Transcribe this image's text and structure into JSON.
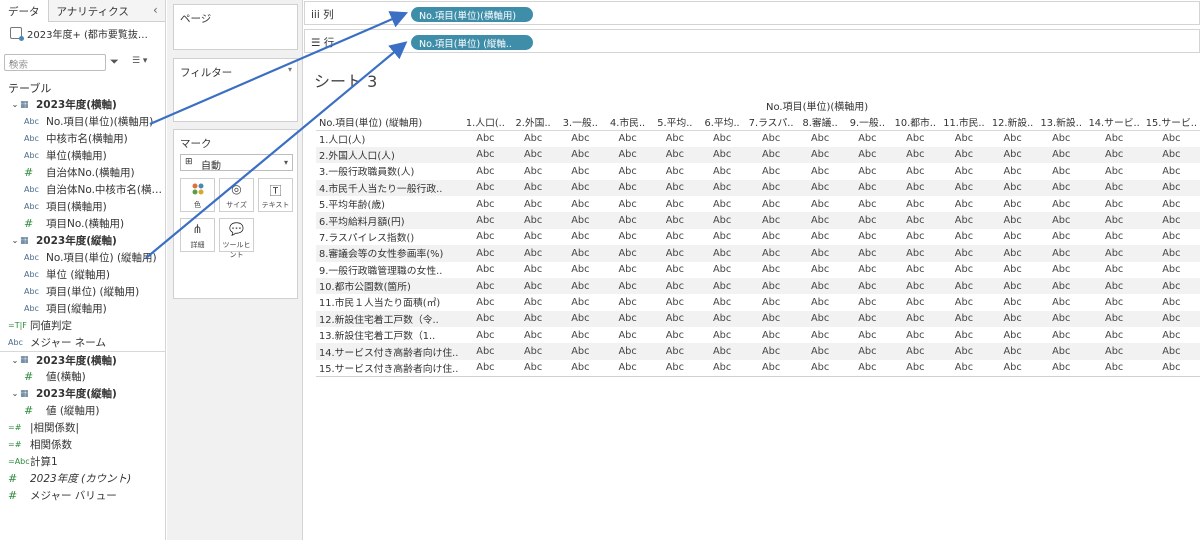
{
  "datapane": {
    "tabs": [
      "データ",
      "アナリティクス"
    ],
    "collapse_glyph": "‹",
    "datasource": "2023年度+ (都市要覧抜…",
    "search_placeholder": "検索",
    "section": "テーブル",
    "fields": [
      {
        "kind": "group",
        "label": "2023年度(横軸)"
      },
      {
        "kind": "field",
        "type": "Abc",
        "label": "No.項目(単位)(横軸用)"
      },
      {
        "kind": "field",
        "type": "Abc",
        "label": "中核市名(横軸用)"
      },
      {
        "kind": "field",
        "type": "Abc",
        "label": "単位(横軸用)"
      },
      {
        "kind": "field",
        "type": "#",
        "label": "自治体No.(横軸用)"
      },
      {
        "kind": "field",
        "type": "Abc",
        "label": "自治体No.中核市名(横…"
      },
      {
        "kind": "field",
        "type": "Abc",
        "label": "項目(横軸用)"
      },
      {
        "kind": "field",
        "type": "#",
        "label": "項目No.(横軸用)"
      },
      {
        "kind": "group",
        "label": "2023年度(縦軸)"
      },
      {
        "kind": "field",
        "type": "Abc",
        "label": "No.項目(単位) (縦軸用)"
      },
      {
        "kind": "field",
        "type": "Abc",
        "label": "単位 (縦軸用)"
      },
      {
        "kind": "field",
        "type": "Abc",
        "label": "項目(単位) (縦軸用)"
      },
      {
        "kind": "field",
        "type": "Abc",
        "label": "項目(縦軸用)"
      },
      {
        "kind": "root",
        "type": "=T|F",
        "label": "同値判定"
      },
      {
        "kind": "root",
        "type": "Abc",
        "label": "メジャー ネーム"
      },
      {
        "kind": "group",
        "label": "2023年度(横軸)",
        "sep": true
      },
      {
        "kind": "field",
        "type": "#",
        "label": "値(横軸)"
      },
      {
        "kind": "group",
        "label": "2023年度(縦軸)"
      },
      {
        "kind": "field",
        "type": "#",
        "label": "値 (縦軸用)"
      },
      {
        "kind": "root",
        "type": "=#",
        "label": "|相関係数|"
      },
      {
        "kind": "root",
        "type": "=#",
        "label": "相関係数"
      },
      {
        "kind": "root",
        "type": "=Abc",
        "label": "計算1"
      },
      {
        "kind": "root",
        "type": "#",
        "label": "2023年度 (カウント)",
        "italic": true
      },
      {
        "kind": "root",
        "type": "#",
        "label": "メジャー バリュー"
      }
    ]
  },
  "cards": {
    "pages_label": "ページ",
    "filters_label": "フィルター",
    "marks_label": "マーク",
    "mark_type": "自動",
    "mark_buttons": [
      {
        "name": "color",
        "label": "色"
      },
      {
        "name": "size",
        "label": "サイズ"
      },
      {
        "name": "text",
        "label": "テキスト"
      },
      {
        "name": "detail",
        "label": "詳細"
      },
      {
        "name": "tooltip",
        "label": "ツールヒント"
      }
    ]
  },
  "view": {
    "columns_shelf_label": "列",
    "rows_shelf_label": "行",
    "columns_pill": "No.項目(単位)(横軸用)",
    "rows_pill": "No.項目(単位) (縦軸..",
    "sheet_title": "シート 3",
    "column_field_header": "No.項目(単位)(横軸用)",
    "row_field_header": "No.項目(単位) (縦軸用)",
    "column_headers": [
      "1.人口(..",
      "2.外国..",
      "3.一般..",
      "4.市民..",
      "5.平均..",
      "6.平均..",
      "7.ラスパ..",
      "8.審議..",
      "9.一般..",
      "10.都市..",
      "11.市民..",
      "12.新設..",
      "13.新設..",
      "14.サービ..",
      "15.サービ.."
    ],
    "row_headers": [
      "1.人口(人)",
      "2.外国人人口(人)",
      "3.一般行政職員数(人)",
      "4.市民千人当たり一般行政..",
      "5.平均年齢(歳)",
      "6.平均給料月額(円)",
      "7.ラスパイレス指数()",
      "8.審議会等の女性参画率(%)",
      "9.一般行政職管理職の女性..",
      "10.都市公園数(箇所)",
      "11.市民１人当たり面積(㎡)",
      "12.新設住宅着工戸数（令..",
      "13.新設住宅着工戸数（1..",
      "14.サービス付き高齢者向け住..",
      "15.サービス付き高齢者向け住.."
    ],
    "cell_value": "Abc"
  },
  "colors": {
    "pill": "#3f8ea9",
    "arrow": "#3a6fc4",
    "green_type": "#2e8b3e",
    "blue_type": "#4a6b8a"
  }
}
